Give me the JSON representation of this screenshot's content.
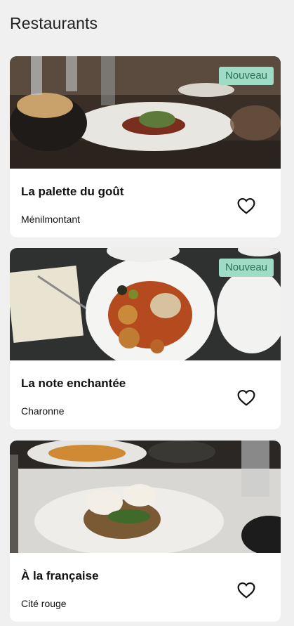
{
  "header": {
    "title": "Restaurants"
  },
  "restaurants": [
    {
      "name": "La palette du goût",
      "area": "Ménilmontant",
      "badge": "Nouveau",
      "favorite": false
    },
    {
      "name": "La note enchantée",
      "area": "Charonne",
      "badge": "Nouveau",
      "favorite": false
    },
    {
      "name": "À la française",
      "area": "Cité rouge",
      "badge": "",
      "favorite": false
    }
  ],
  "colors": {
    "badge_bg": "#9fdcc6",
    "badge_text": "#2c6f5a",
    "background": "#f0f0f0"
  },
  "icons": {
    "favorite": "heart-outline-icon"
  }
}
